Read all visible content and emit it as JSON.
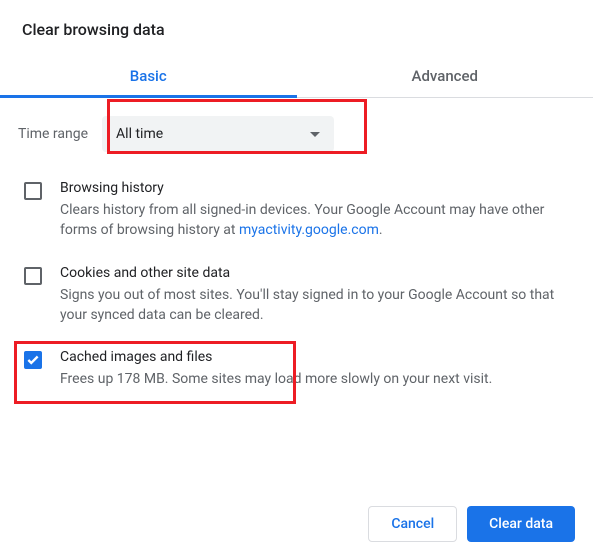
{
  "title": "Clear browsing data",
  "tabs": {
    "basic": "Basic",
    "advanced": "Advanced"
  },
  "time": {
    "label": "Time range",
    "value": "All time"
  },
  "options": {
    "browsing": {
      "title": "Browsing history",
      "desc_before": "Clears history from all signed-in devices. Your Google Account may have other forms of browsing history at ",
      "link_text": "myactivity.google.com",
      "desc_after": ".",
      "checked": false
    },
    "cookies": {
      "title": "Cookies and other site data",
      "desc": "Signs you out of most sites. You'll stay signed in to your Google Account so that your synced data can be cleared.",
      "checked": false
    },
    "cached": {
      "title": "Cached images and files",
      "desc": "Frees up 178 MB. Some sites may load more slowly on your next visit.",
      "checked": true
    }
  },
  "actions": {
    "cancel": "Cancel",
    "clear": "Clear data"
  }
}
